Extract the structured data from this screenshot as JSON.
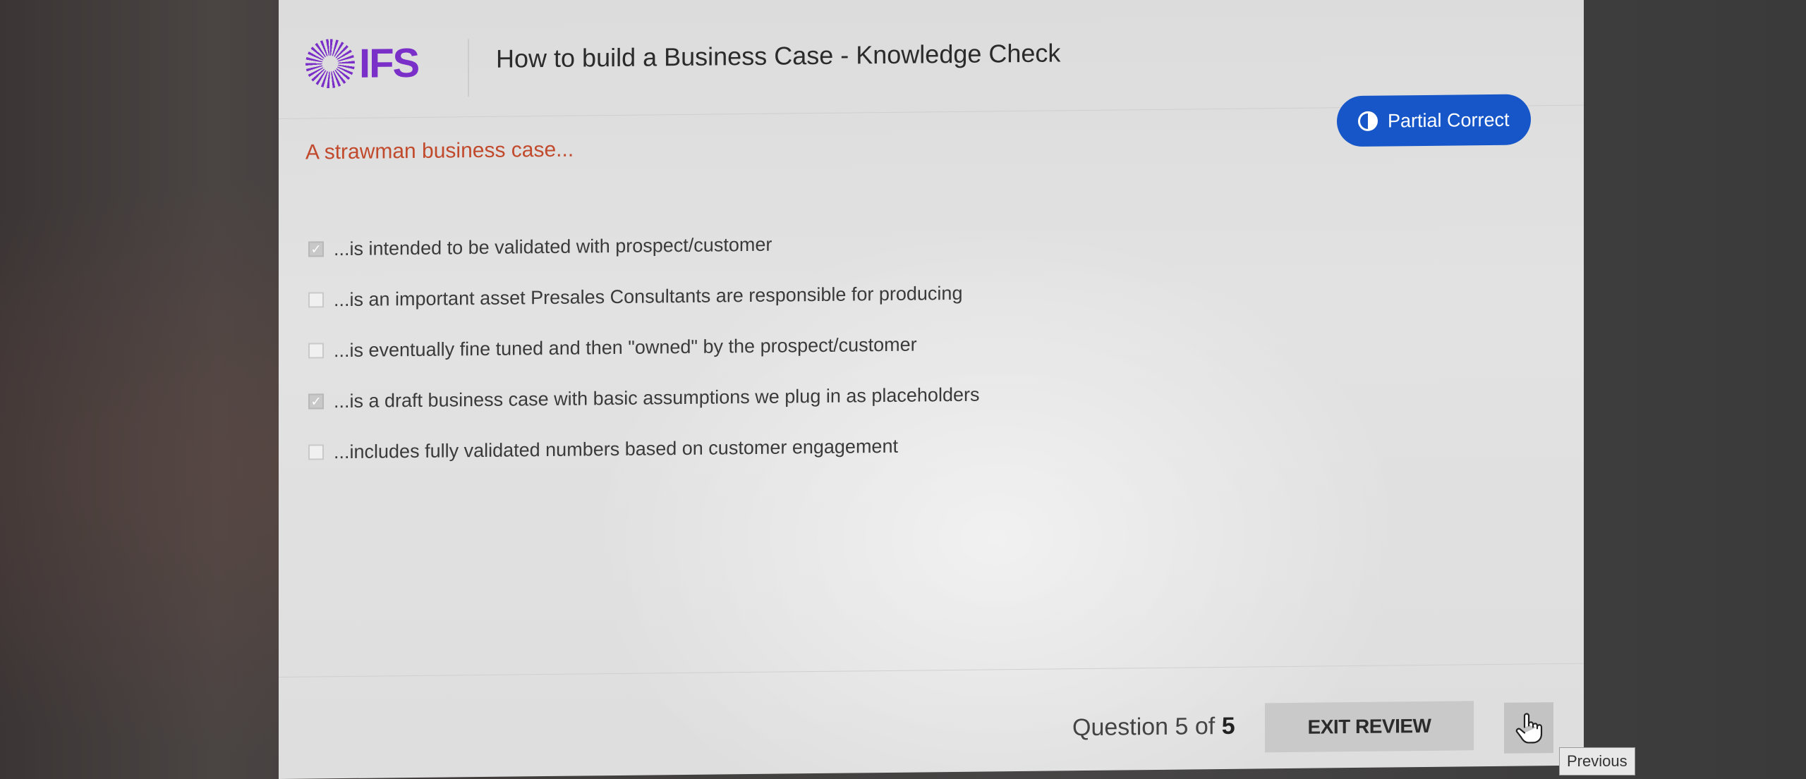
{
  "header": {
    "logo_text": "IFS",
    "title": "How to build a Business Case - Knowledge Check"
  },
  "question": {
    "text": "A strawman business case...",
    "status_badge": "Partial Correct",
    "options": [
      {
        "label": "...is intended to be validated with prospect/customer",
        "checked": true
      },
      {
        "label": "...is an important asset Presales Consultants are responsible for producing",
        "checked": false
      },
      {
        "label": "...is eventually fine tuned and then \"owned\" by the prospect/customer",
        "checked": false
      },
      {
        "label": "...is a draft business case with basic assumptions we plug in as placeholders",
        "checked": true
      },
      {
        "label": "...includes fully validated numbers based on customer engagement",
        "checked": false
      }
    ]
  },
  "footer": {
    "progress_prefix": "Question 5 of ",
    "progress_total": "5",
    "exit_label": "EXIT REVIEW",
    "previous_tooltip": "Previous"
  },
  "colors": {
    "brand": "#7a2fc9",
    "question_text": "#c24a2c",
    "badge_bg": "#1756c8"
  },
  "icons": {
    "logo": "ifs-logo-icon",
    "badge": "half-circle-icon",
    "previous": "hand-pointer-icon"
  }
}
